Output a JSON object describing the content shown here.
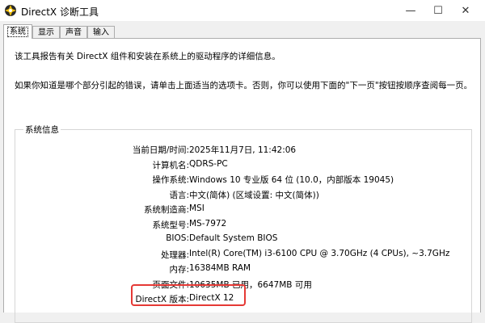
{
  "window": {
    "title": "DirectX 诊断工具",
    "minimize_glyph": "—",
    "maximize_glyph": "☐",
    "close_glyph": "✕"
  },
  "tabs": [
    {
      "label": "系统",
      "active": true
    },
    {
      "label": "显示",
      "active": false
    },
    {
      "label": "声音",
      "active": false
    },
    {
      "label": "输入",
      "active": false
    }
  ],
  "description": {
    "line1": "该工具报告有关 DirectX 组件和安装在系统上的驱动程序的详细信息。",
    "line2": "如果你知道是哪个部分引起的错误，请单击上面适当的选项卡。否则，你可以使用下面的\"下一页\"按钮按顺序查阅每一页。"
  },
  "system_info": {
    "group_title": "系统信息",
    "rows": [
      {
        "label": "当前日期/时间:",
        "value": "2025年11月7日, 11:42:06"
      },
      {
        "label": "计算机名:",
        "value": "QDRS-PC"
      },
      {
        "label": "操作系统:",
        "value": "Windows 10 专业版 64 位 (10.0，内部版本 19045)"
      },
      {
        "label": "语言:",
        "value": "中文(简体) (区域设置: 中文(简体))"
      },
      {
        "label": "系统制造商:",
        "value": "MSI"
      },
      {
        "label": "系统型号:",
        "value": "MS-7972"
      },
      {
        "label": "BIOS:",
        "value": "Default System BIOS"
      },
      {
        "label": "处理器:",
        "value": "Intel(R) Core(TM) i3-6100 CPU @ 3.70GHz (4 CPUs), ~3.7GHz"
      },
      {
        "label": "内存:",
        "value": "16384MB RAM"
      },
      {
        "label": "页面文件:",
        "value": "10635MB 已用，6647MB 可用"
      },
      {
        "label": "DirectX 版本:",
        "value": "DirectX 12"
      }
    ]
  },
  "colors": {
    "highlight": "#e53935",
    "app_icon_ring": "#2a2a2a",
    "app_icon_accent": "#f4c20d"
  },
  "icons": {
    "app": "directx-icon"
  }
}
